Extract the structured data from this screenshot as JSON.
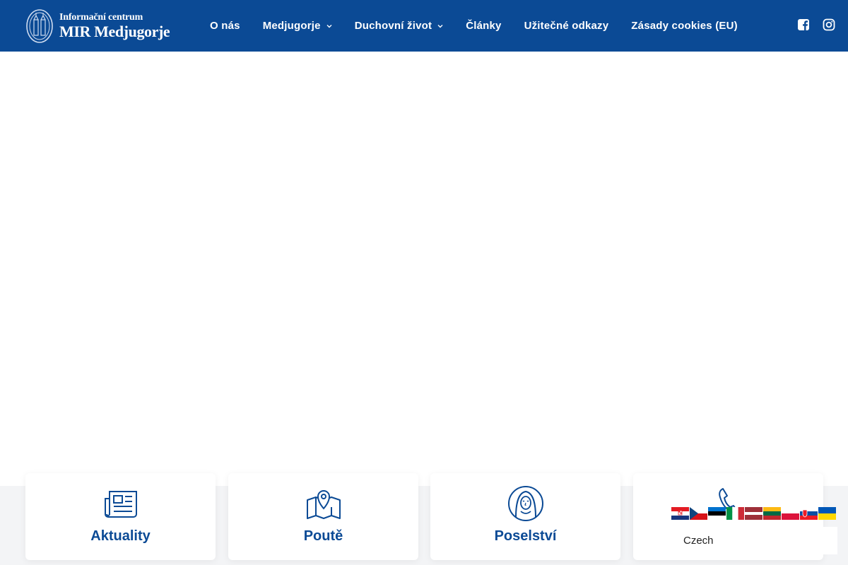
{
  "header": {
    "logo": {
      "line1": "Informační centrum",
      "line2": "MIR Medjugorje"
    },
    "nav": [
      {
        "label": "O nás",
        "has_dropdown": false
      },
      {
        "label": "Medjugorje",
        "has_dropdown": true
      },
      {
        "label": "Duchovní život",
        "has_dropdown": true
      },
      {
        "label": "Články",
        "has_dropdown": false
      },
      {
        "label": "Užitečné odkazy",
        "has_dropdown": false
      },
      {
        "label": "Zásady cookies (EU)",
        "has_dropdown": false
      }
    ],
    "social_icons": [
      "facebook-icon",
      "instagram-icon"
    ]
  },
  "cards": [
    {
      "title": "Aktuality",
      "icon": "newspaper-icon"
    },
    {
      "title": "Poutě",
      "icon": "map-pin-icon"
    },
    {
      "title": "Poselství",
      "icon": "madonna-icon"
    },
    {
      "title": "",
      "icon": "phone-icon"
    }
  ],
  "language": {
    "flags": [
      "croatia",
      "czech",
      "estonia",
      "italy",
      "latvia",
      "lithuania",
      "poland",
      "slovakia",
      "ukraine"
    ],
    "selected": "Czech"
  },
  "colors": {
    "brand": "#0b4a95",
    "band": "#f3f4f6"
  }
}
